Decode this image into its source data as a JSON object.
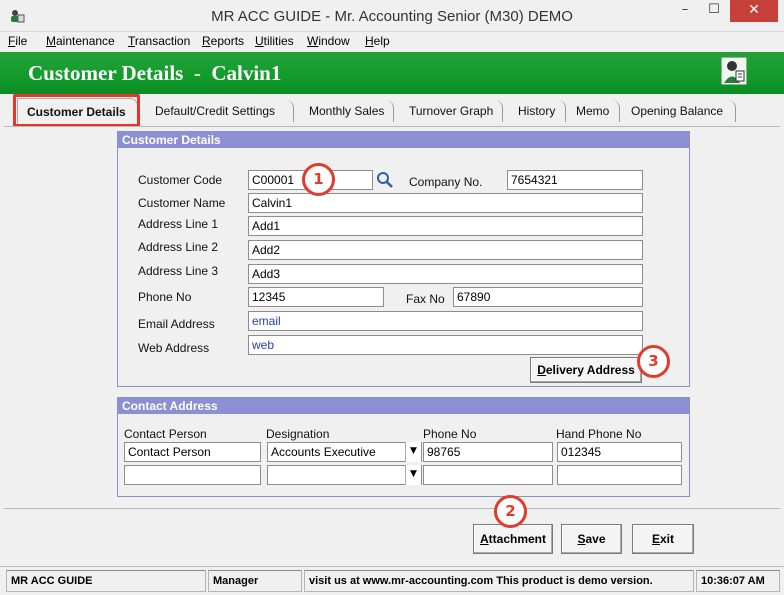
{
  "window": {
    "title": "MR ACC GUIDE - Mr. Accounting Senior (M30) DEMO",
    "min_label": "–",
    "max_label": "☐",
    "close_label": "✕"
  },
  "menu": [
    "File",
    "Maintenance",
    "Transaction",
    "Reports",
    "Utilities",
    "Window",
    "Help"
  ],
  "banner": {
    "title": "Customer Details  -  Calvin1",
    "icon": "customer-person-icon"
  },
  "tabs": [
    "Customer Details",
    "Default/Credit Settings",
    "Monthly Sales",
    "Turnover Graph",
    "History",
    "Memo",
    "Opening Balance"
  ],
  "customer_details": {
    "header": "Customer Details",
    "customer_code_label": "Customer Code",
    "customer_code": "C00001",
    "company_no_label": "Company No.",
    "company_no": "7654321",
    "customer_name_label": "Customer Name",
    "customer_name": "Calvin1",
    "address1_label": "Address Line 1",
    "address1": "Add1",
    "address2_label": "Address Line 2",
    "address2": "Add2",
    "address3_label": "Address Line 3",
    "address3": "Add3",
    "phone_label": "Phone No",
    "phone": "12345",
    "fax_label": "Fax No",
    "fax": "67890",
    "email_label": "Email Address",
    "email": "email",
    "web_label": "Web Address",
    "web": "web",
    "delivery_button": "Delivery Address"
  },
  "contact_address": {
    "header": "Contact Address",
    "columns": [
      "Contact Person",
      "Designation",
      "Phone No",
      "Hand Phone No"
    ],
    "rows": [
      [
        "Contact Person",
        "Accounts Executive",
        "98765",
        "012345"
      ],
      [
        "",
        "",
        "",
        ""
      ]
    ]
  },
  "buttons": {
    "attachment": "Attachment",
    "save": "Save",
    "exit": "Exit"
  },
  "callouts": [
    "1",
    "2",
    "3"
  ],
  "status": {
    "app": "MR ACC GUIDE",
    "user": "Manager",
    "message": "visit us at www.mr-accounting.com This product is demo version.",
    "time": "10:36:07 AM"
  },
  "colors": {
    "banner_green": "#119c2b",
    "group_header": "#8c8fd4",
    "callout_red": "#e23b2c"
  }
}
